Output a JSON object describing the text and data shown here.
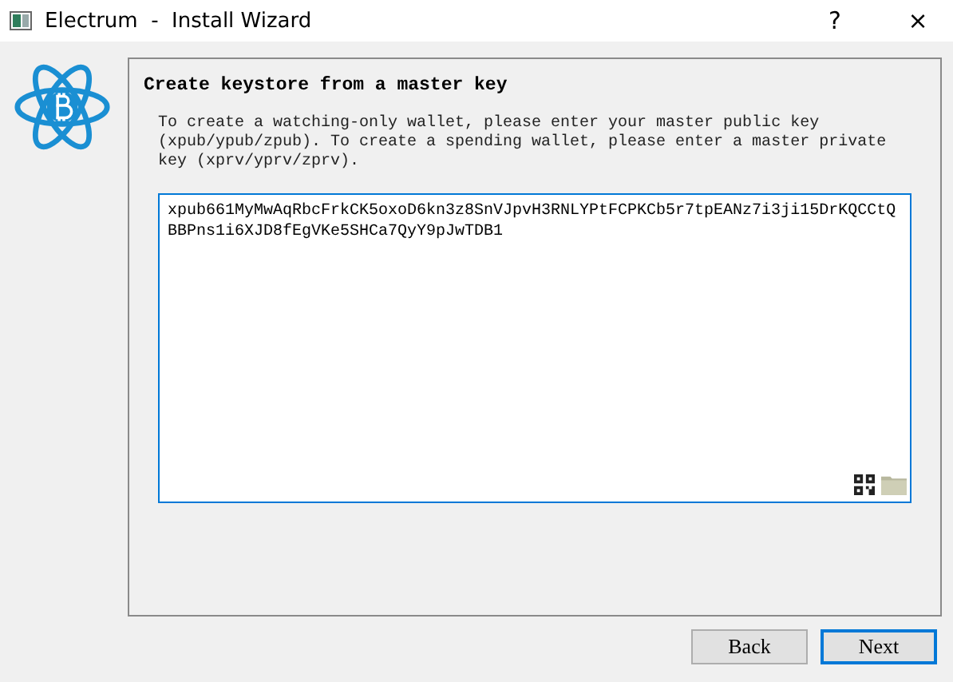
{
  "window": {
    "title": "Electrum  -  Install Wizard",
    "help": "?",
    "close": "×"
  },
  "panel": {
    "title": "Create keystore from a master key",
    "message": "To create a watching-only wallet, please enter your master public key (xpub/ypub/zpub). To create a spending wallet, please enter a master private key (xprv/yprv/zprv).",
    "key_field": {
      "value": "xpub661MyMwAqRbcFrkCK5oxoD6kn3z8SnVJpvH3RNLYPtFCPKCb5r7tpEANz7i3ji15DrKQCCtQBBPns1i6XJD8fEgVKe5SHCa7QyY9pJwTDB1"
    }
  },
  "buttons": [
    {
      "label": "Back",
      "kind": "secondary"
    },
    {
      "label": "Next",
      "kind": "default"
    }
  ]
}
